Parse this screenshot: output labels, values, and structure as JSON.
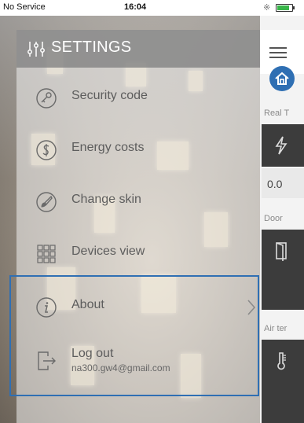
{
  "status_bar": {
    "carrier": "No Service",
    "time": "16:04"
  },
  "drawer": {
    "title": "SETTINGS",
    "items": [
      {
        "label": "Security code",
        "icon": "key-icon"
      },
      {
        "label": "Energy costs",
        "icon": "money-icon"
      },
      {
        "label": "Change skin",
        "icon": "brush-icon"
      },
      {
        "label": "Devices view",
        "icon": "grid-icon"
      },
      {
        "label": "About",
        "icon": "info-icon",
        "has_chevron": true
      },
      {
        "label": "Log out",
        "icon": "logout-icon",
        "sublabel": "na300.gw4@gmail.com"
      }
    ]
  },
  "main": {
    "sections": [
      {
        "label": "Real T",
        "value": "0.0"
      },
      {
        "label": "Door"
      },
      {
        "label": "Air ter"
      }
    ]
  },
  "colors": {
    "accent": "#2f6fb3",
    "header_gray": "#828282",
    "tile_dark": "#3c3c3c"
  }
}
